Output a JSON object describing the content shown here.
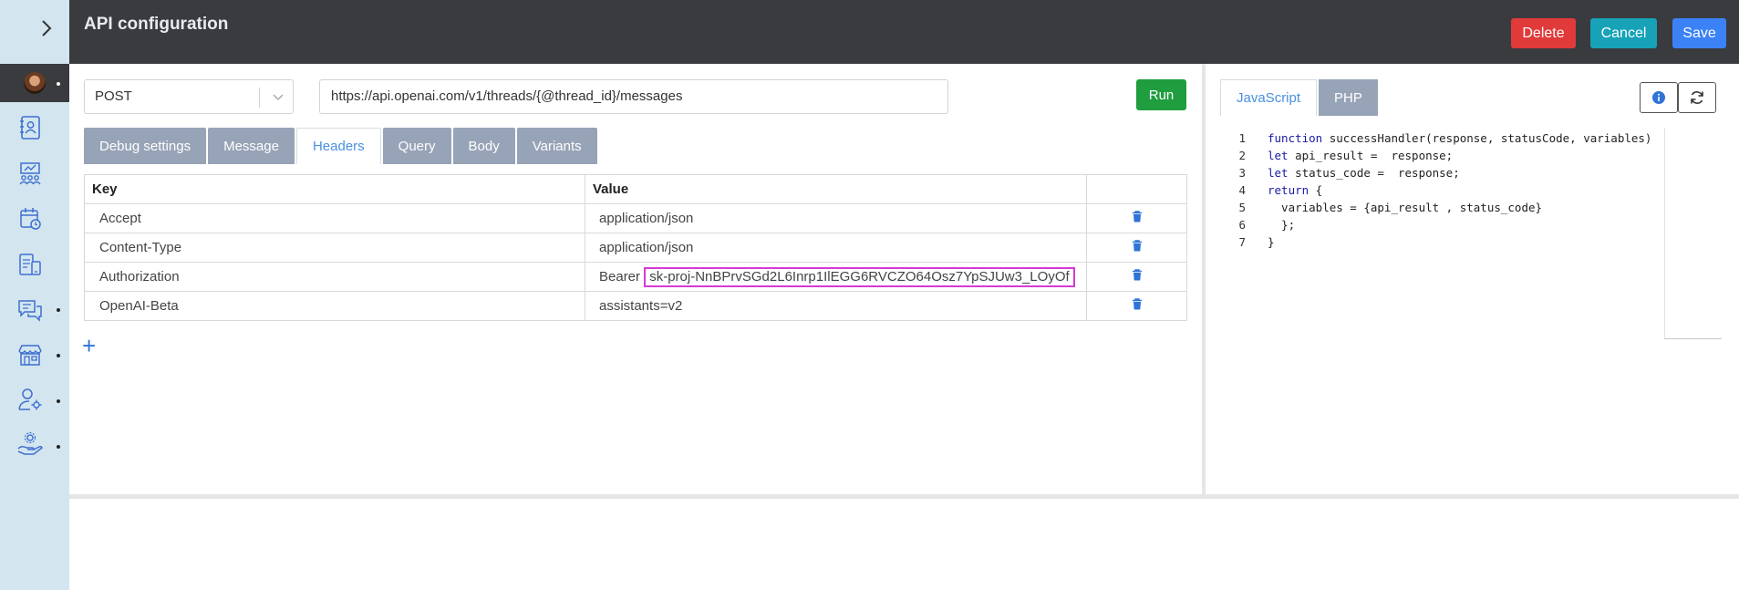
{
  "header": {
    "title": "API configuration",
    "delete_label": "Delete",
    "cancel_label": "Cancel",
    "save_label": "Save",
    "colors": {
      "delete": "#e03a3a",
      "cancel": "#17a2b8",
      "save": "#3b82f6"
    }
  },
  "sidebar": {
    "items": [
      {
        "icon": "contacts-icon",
        "has_dot": false
      },
      {
        "icon": "team-board-icon",
        "has_dot": false
      },
      {
        "icon": "calendar-clock-icon",
        "has_dot": false
      },
      {
        "icon": "devices-icon",
        "has_dot": false
      },
      {
        "icon": "chat-icon",
        "has_dot": true
      },
      {
        "icon": "store-icon",
        "has_dot": true
      },
      {
        "icon": "user-settings-icon",
        "has_dot": true
      },
      {
        "icon": "hand-gear-icon",
        "has_dot": true
      }
    ]
  },
  "request": {
    "method": "POST",
    "url": "https://api.openai.com/v1/threads/{@thread_id}/messages",
    "run_label": "Run"
  },
  "tabs": [
    {
      "label": "Debug settings",
      "active": false
    },
    {
      "label": "Message",
      "active": false
    },
    {
      "label": "Headers",
      "active": true
    },
    {
      "label": "Query",
      "active": false
    },
    {
      "label": "Body",
      "active": false
    },
    {
      "label": "Variants",
      "active": false
    }
  ],
  "headers_table": {
    "columns": [
      "Key",
      "Value"
    ],
    "rows": [
      {
        "key": "Accept",
        "value_prefix": "",
        "value": "application/json"
      },
      {
        "key": "Content-Type",
        "value_prefix": "",
        "value": "application/json"
      },
      {
        "key": "Authorization",
        "value_prefix": "Bearer ",
        "value": "sk-proj-NnBPrvSGd2L6Inrp1IlEGG6RVCZO64Osz7YpSJUw3_LOyOf"
      },
      {
        "key": "OpenAI-Beta",
        "value_prefix": "",
        "value": "assistants=v2"
      }
    ]
  },
  "add_label": "+",
  "code_panel": {
    "tabs": [
      {
        "label": "JavaScript",
        "active": true
      },
      {
        "label": "PHP",
        "active": false
      }
    ],
    "lines": [
      {
        "n": "1",
        "text": "function successHandler(response, statusCode, variables)"
      },
      {
        "n": "2",
        "text": "let api_result =  response;"
      },
      {
        "n": "3",
        "text": "let status_code =  response;"
      },
      {
        "n": "4",
        "text": "return {"
      },
      {
        "n": "5",
        "text": "  variables = {api_result , status_code}"
      },
      {
        "n": "6",
        "text": "  };"
      },
      {
        "n": "7",
        "text": "}"
      }
    ]
  }
}
